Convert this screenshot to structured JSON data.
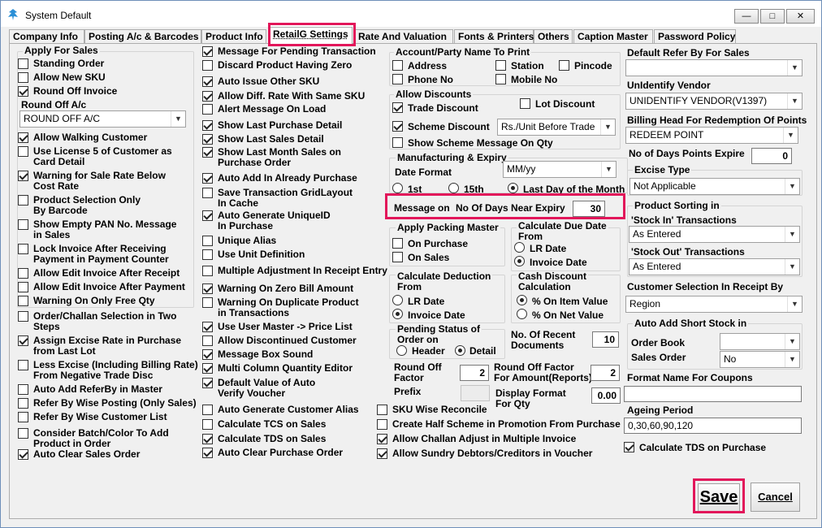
{
  "window": {
    "title": "System Default"
  },
  "tabs": [
    "Company Info",
    "Posting A/c & Barcodes",
    "Product Info",
    "RetailG Settings",
    "Rate And Valuation",
    "Fonts & Printers",
    "Others",
    "Caption Master",
    "Password Policy"
  ],
  "col1": {
    "apply_for_sales": "Apply For Sales",
    "standing_order": "Standing Order",
    "allow_new_sku": "Allow New SKU",
    "round_off_invoice": "Round Off Invoice",
    "round_off_ac": "Round Off A/c",
    "round_off_ac_value": "ROUND OFF A/C",
    "allow_walking_customer": "Allow Walking Customer",
    "use_license5": [
      "Use License 5 of Customer as",
      "Card Detail"
    ],
    "warning_rate_below": [
      "Warning for Sale Rate Below",
      "Cost Rate"
    ],
    "product_selection": [
      "Product Selection Only",
      "By Barcode"
    ],
    "show_empty_pan": [
      "Show Empty PAN No. Message",
      "in Sales"
    ],
    "lock_invoice": [
      "Lock Invoice After Receiving",
      " Payment in Payment Counter"
    ],
    "allow_edit_receipt": "Allow Edit Invoice After Receipt",
    "allow_edit_payment": "Allow Edit Invoice After Payment",
    "warning_free_qty": "Warning On Only Free Qty",
    "order_challan": [
      "Order/Challan Selection in Two",
      "Steps"
    ],
    "assign_excise": [
      "Assign Excise Rate in Purchase",
      "from Last Lot"
    ],
    "less_excise": [
      "Less Excise (Including Billing Rate)",
      " From Negative Trade Disc"
    ],
    "auto_add_referby": "Auto Add ReferBy in Master",
    "refer_by_wise": "Refer By Wise Posting (Only Sales)",
    "refer_by_customer": "Refer By Wise Customer List",
    "consider_batch": [
      "Consider Batch/Color To Add",
      "Product in Order"
    ],
    "auto_clear_sales": "Auto Clear Sales Order"
  },
  "col2": {
    "msg_pending_txn": "Message For Pending Transaction",
    "discard_zero": "Discard Product Having Zero",
    "auto_issue_sku": "Auto Issue Other SKU",
    "allow_diff_rate": "Allow Diff. Rate With Same SKU",
    "alert_load": "Alert Message On Load",
    "last_purchase": "Show Last Purchase Detail",
    "last_sales": "Show Last Sales Detail",
    "last_month": [
      "Show Last Month Sales on",
      "Purchase Order"
    ],
    "auto_add_purchase": "Auto Add In Already Purchase",
    "save_grid": [
      "Save Transaction GridLayout",
      "In Cache"
    ],
    "auto_uid": [
      "Auto Generate UniqueID",
      "In Purchase"
    ],
    "unique_alias": "Unique Alias",
    "use_unit_def": "Use Unit Definition",
    "multi_adj": "Multiple Adjustment In Receipt Entry",
    "zero_bill": "Warning On Zero Bill Amount",
    "dup_product": [
      "Warning On Duplicate Product",
      " in Transactions"
    ],
    "use_user_master": "Use User Master -> Price List",
    "allow_disc_cust": "Allow Discontinued Customer",
    "msg_box_sound": "Message Box Sound",
    "multi_col_qty": "Multi Column Quantity Editor",
    "default_auto": [
      "Default Value of Auto",
      "Verify Voucher"
    ],
    "auto_cust_alias": "Auto Generate Customer Alias",
    "calc_tcs": "Calculate TCS on Sales",
    "calc_tds_sales": "Calculate TDS on Sales",
    "auto_clear_purchase": "Auto Clear Purchase Order"
  },
  "col3": {
    "account_party": "Account/Party Name To Print",
    "address": "Address",
    "station": "Station",
    "pincode": "Pincode",
    "phone": "Phone No",
    "mobile": "Mobile No",
    "allow_discounts": "Allow Discounts",
    "trade_discount": "Trade Discount",
    "lot_discount": "Lot Discount",
    "scheme_discount": "Scheme Discount",
    "scheme_value": "Rs./Unit Before Trade",
    "show_scheme_msg": "Show Scheme Message On Qty",
    "mfg_expiry": "Manufacturing & Expiry",
    "date_format": "Date Format",
    "date_format_value": "MM/yy",
    "r_1st": "1st",
    "r_15th": "15th",
    "r_last": "Last  Day of the Month",
    "message_on": "Message on",
    "near_expiry": "No Of Days Near Expiry",
    "near_expiry_value": "30",
    "apply_packing": "Apply Packing Master",
    "on_purchase": "On Purchase",
    "on_sales": "On Sales",
    "calc_due": [
      "Calculate Due Date",
      "From"
    ],
    "lr_date": "LR Date",
    "invoice_date": "Invoice Date",
    "calc_deduction": [
      "Calculate Deduction",
      "From"
    ],
    "ded_lr": "LR Date",
    "ded_invoice": "Invoice Date",
    "cash_discount": [
      "Cash Discount",
      "Calculation"
    ],
    "on_item_value": "% On Item Value",
    "on_net_value": "% On Net Value",
    "pending_status": [
      "Pending Status of",
      "Order on"
    ],
    "header": "Header",
    "detail": "Detail",
    "recent_docs": [
      "No. Of Recent",
      "Documents"
    ],
    "recent_docs_value": "10",
    "round_off_factor": [
      "Round Off",
      "Factor"
    ],
    "round_off_factor_value": "2",
    "rof_amount": [
      "Round Off Factor",
      "For Amount(Reports)"
    ],
    "rof_amount_value": "2",
    "prefix": "Prefix",
    "display_format": [
      "Display Format",
      "For Qty"
    ],
    "display_format_value": "0.00",
    "sku_wise": "SKU Wise Reconcile",
    "half_scheme": "Create Half Scheme in Promotion From Purchase",
    "challan_adjust": "Allow Challan Adjust in Multiple Invoice",
    "sundry": "Allow Sundry Debtors/Creditors in Voucher"
  },
  "col4": {
    "default_refer": "Default Refer By For Sales",
    "default_refer_value": "",
    "unidentify_vendor": "UnIdentify Vendor",
    "unidentify_vendor_value": "UNIDENTIFY VENDOR(V1397)",
    "billing_head": "Billing Head For Redemption Of Points",
    "billing_head_value": "REDEEM POINT",
    "days_points": "No of Days Points Expire",
    "days_points_value": "0",
    "excise_type": "Excise Type",
    "excise_type_value": "Not Applicable",
    "product_sorting": "Product Sorting in",
    "stock_in": "'Stock In' Transactions",
    "stock_in_value": "As Entered",
    "stock_out": "'Stock Out' Transactions",
    "stock_out_value": "As Entered",
    "cust_selection": "Customer Selection In Receipt By",
    "cust_selection_value": "Region",
    "auto_add_short": "Auto Add Short Stock in",
    "order_book": "Order Book",
    "order_book_value": "",
    "sales_order": "Sales Order",
    "sales_order_value": "No",
    "format_coupons": "Format Name For Coupons",
    "format_coupons_value": "",
    "ageing": "Ageing Period",
    "ageing_value": "0,30,60,90,120",
    "calc_tds_purchase": "Calculate TDS on Purchase"
  },
  "buttons": {
    "save": "Save",
    "cancel": "Cancel"
  }
}
